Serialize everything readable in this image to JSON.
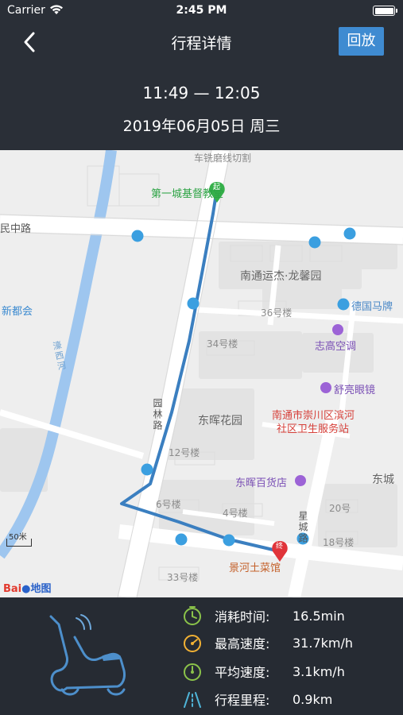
{
  "status": {
    "carrier": "Carrier",
    "time": "2:45 PM"
  },
  "nav": {
    "title": "行程详情",
    "replay_label": "回放"
  },
  "trip": {
    "time_range": "11:49 — 12:05",
    "date": "2019年06月05日 周三"
  },
  "map": {
    "labels": {
      "road_top": "车铣磨线切割",
      "start_place": "第一城基督教堂",
      "road_left": "民中路",
      "poi_yuntong": "南通运杰·龙馨园",
      "poi_36": "36号楼",
      "poi_deguo": "德国马牌",
      "poi_zhigao": "志高空调",
      "poi_34": "34号楼",
      "poi_xindu": "新都会",
      "poi_shuliang": "舒亮眼镜",
      "poi_donghui": "东晖花园",
      "poi_clinic_1": "南通市崇川区滨河",
      "poi_clinic_2": "社区卫生服务站",
      "road_yuanlin": "园林路",
      "poi_12": "12号楼",
      "poi_dept": "东晖百货店",
      "poi_dongcheng": "东城",
      "poi_6": "6号楼",
      "poi_4": "4号楼",
      "road_xingcheng": "星城路",
      "poi_20": "20号",
      "poi_18": "18号楼",
      "end_place": "景河土菜馆",
      "poi_33": "33号楼",
      "river": "濠西河",
      "start_marker": "起",
      "end_marker": "终",
      "scale": "50米",
      "logo_bai": "Bai",
      "logo_map": "地图"
    }
  },
  "stats": [
    {
      "icon": "stopwatch-icon",
      "label": "消耗时间:",
      "value": "16.5min",
      "color": "#8bc34a"
    },
    {
      "icon": "speedometer-max-icon",
      "label": "最高速度:",
      "value": "31.7km/h",
      "color": "#f2b134"
    },
    {
      "icon": "speedometer-avg-icon",
      "label": "平均速度:",
      "value": "3.1km/h",
      "color": "#8bc34a"
    },
    {
      "icon": "road-distance-icon",
      "label": "行程里程:",
      "value": "0.9km",
      "color": "#4fb4d8"
    }
  ],
  "colors": {
    "route": "#3b7fc0",
    "replay_button": "#3f8bd1",
    "header_bg": "#2a2f37",
    "panel_bg": "#262b33"
  }
}
